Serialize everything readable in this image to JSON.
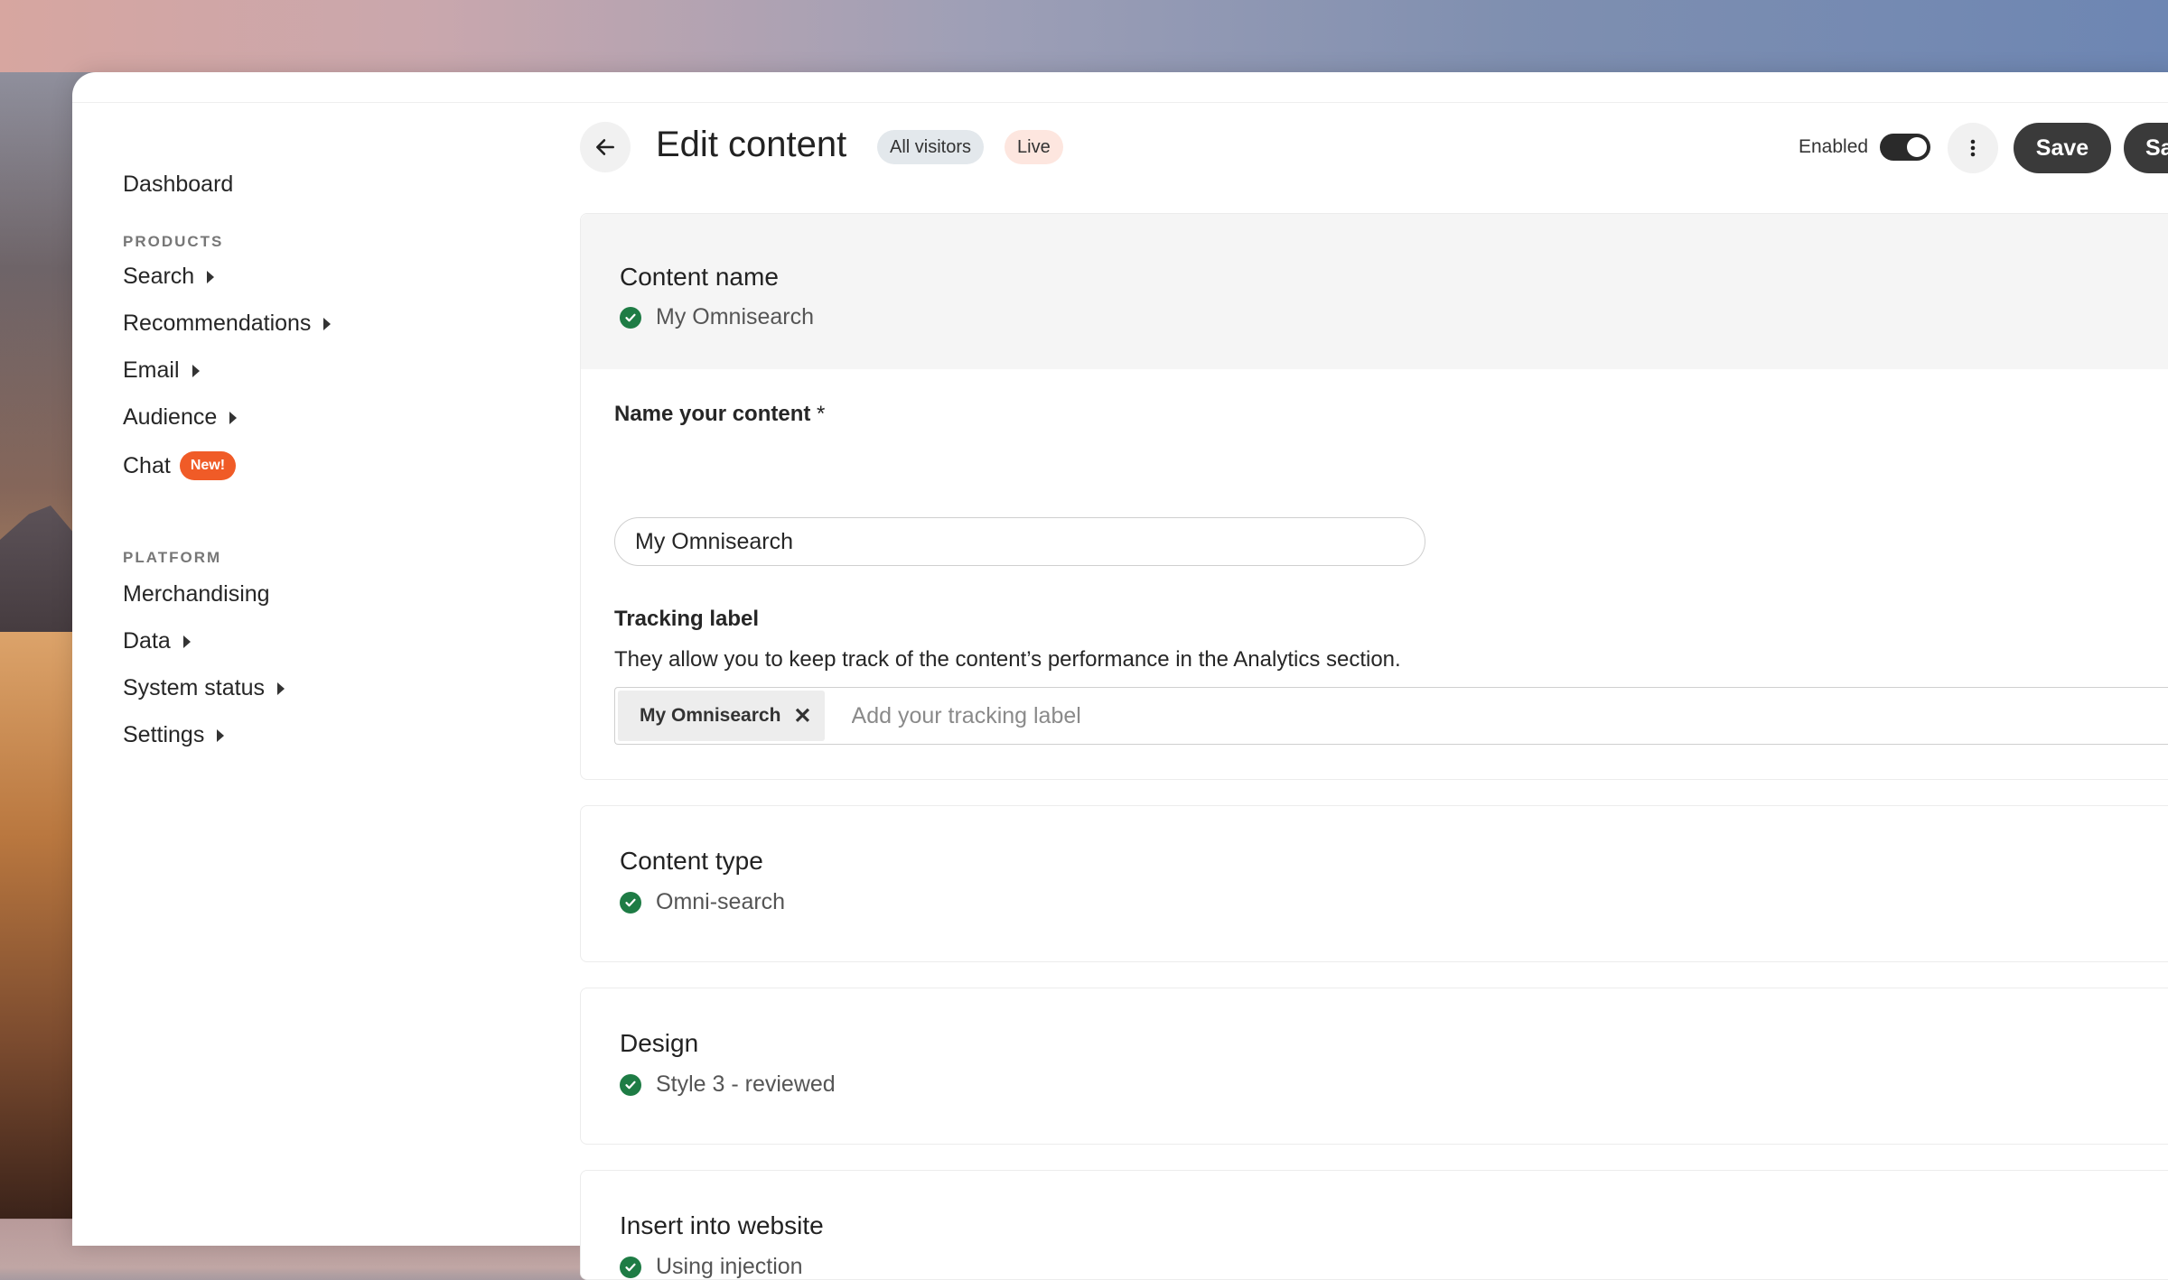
{
  "sidebar": {
    "dashboard": "Dashboard",
    "products_label": "PRODUCTS",
    "products": [
      {
        "label": "Search"
      },
      {
        "label": "Recommendations"
      },
      {
        "label": "Email"
      },
      {
        "label": "Audience"
      }
    ],
    "chat": {
      "label": "Chat",
      "badge": "New!"
    },
    "platform_label": "PLATFORM",
    "platform": [
      {
        "label": "Merchandising"
      },
      {
        "label": "Data"
      },
      {
        "label": "System status"
      },
      {
        "label": "Settings"
      }
    ]
  },
  "header": {
    "title": "Edit content",
    "audience_pill": "All visitors",
    "status_pill": "Live",
    "enabled_label": "Enabled",
    "enabled": true,
    "save_label": "Save",
    "save_secondary_label": "Sa"
  },
  "content_name": {
    "title": "Content name",
    "value": "My Omnisearch",
    "name_label": "Name your content",
    "required_mark": "*",
    "name_value": "My Omnisearch",
    "tracking_label": "Tracking label",
    "tracking_help": "They allow you to keep track of the content’s performance in the Analytics section.",
    "tracking_tag": "My Omnisearch",
    "tracking_placeholder": "Add your tracking label"
  },
  "content_type": {
    "title": "Content type",
    "value": "Omni-search"
  },
  "design": {
    "title": "Design",
    "value": "Style 3 - reviewed"
  },
  "insert": {
    "title": "Insert into website",
    "value": "Using injection"
  },
  "colors": {
    "accent": "#3a3a3a",
    "check": "#1e7c45",
    "new_badge": "#f05b27"
  }
}
